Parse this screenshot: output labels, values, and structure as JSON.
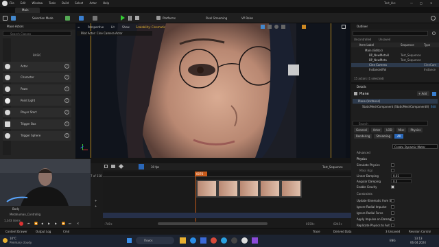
{
  "window": {
    "title": "Test_kks",
    "level_tab": "Main"
  },
  "menu": [
    "File",
    "Edit",
    "Window",
    "Tools",
    "Build",
    "Select",
    "Actor",
    "Help"
  ],
  "toolbar": {
    "selection_mode": "Selection Mode",
    "platforms": "Platforms",
    "pixel_streaming": "Pixel Streaming",
    "vr_modes": "VP Roles"
  },
  "place_actors": {
    "title": "Place Actors",
    "search_placeholder": "Search Classes",
    "basic_label": "BASIC",
    "items": [
      "Actor",
      "Character",
      "Pawn",
      "Point Light",
      "Player Start",
      "Trigger Box",
      "Trigger Sphere"
    ]
  },
  "viewport": {
    "perspective": "Perspective",
    "lit": "Lit",
    "show": "Show",
    "scalability": "Scalability: Cinematic",
    "pilot_label": "Pilot Actor: Cine Camera Actor"
  },
  "outliner": {
    "title": "Outliner",
    "columns": [
      "Item Label",
      "Type"
    ],
    "filters": [
      "Uncontrolled",
      "Unsaved"
    ],
    "sequence_col": "Sequence",
    "rows": [
      {
        "label": "Main (Editor)",
        "type": ""
      },
      {
        "label": "BP_NewMetaH",
        "type": "Test_Sequence"
      },
      {
        "label": "BP_NewMeta",
        "type": "Test_Sequence"
      },
      {
        "label": "Cine Camera",
        "type": "CineCam"
      },
      {
        "label": "InstancedFol",
        "type": "Instance"
      }
    ],
    "count": "15 actors (1 selected)"
  },
  "details": {
    "title": "Details",
    "actor_name": "Plane",
    "add_label": "+ Add",
    "instance": "Plane (Instance)",
    "component": "StaticMeshComponent (StaticMeshComponent0)",
    "edit": "Edit",
    "search_placeholder": "Search",
    "tabs_row1": [
      "General",
      "Actor",
      "LOD",
      "Misc",
      "Physics"
    ],
    "tabs_row2": [
      "Rendering",
      "Streaming",
      "All"
    ],
    "tooltip": "Create Dynamic Mater",
    "advanced": "Advanced",
    "physics_header": "Physics",
    "physics_props": [
      {
        "label": "Simulate Physics",
        "value": ""
      },
      {
        "label": "Mass (kg)",
        "value": ""
      },
      {
        "label": "Linear Damping",
        "value": "0.01"
      },
      {
        "label": "Angular Damping",
        "value": "0.0"
      },
      {
        "label": "Enable Gravity",
        "value": ""
      }
    ],
    "constraints": "Constraints",
    "more_props": [
      "Update Kinematic from Si",
      "Ignore Radial Impulse",
      "Ignore Radial Force",
      "Apply Impulse on Damage",
      "Replicate Physics to Aut"
    ]
  },
  "sequencer": {
    "fps": "30 fps",
    "sequence_name": "Test_Sequence",
    "current_frame": "0076",
    "track_frame": "7 of 118",
    "start": "-740+",
    "end": "0159+",
    "end2": "0245+"
  },
  "content_browser": {
    "body_label": "Body",
    "item": "Metahuman_Controllig",
    "count": "1,343 items"
  },
  "status": {
    "content_drawer": "Content Drawer",
    "output_log": "Output Log",
    "cmd": "Cmd",
    "trace": "Trace",
    "derived_data": "Derived Data",
    "unsaved": "3 Unsaved",
    "revision": "Revision Control"
  },
  "taskbar": {
    "weather_temp": "10°C",
    "weather_desc": "Preimary cloudy",
    "search_placeholder": "Поиск",
    "lang": "ENG",
    "time": "13:13",
    "date": "06.04.2024"
  }
}
